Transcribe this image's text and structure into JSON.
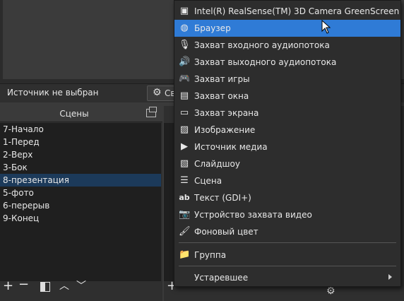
{
  "source_bar": {
    "label": "Источник не выбран",
    "button_label": "Св"
  },
  "scenes": {
    "title": "Сцены",
    "items": [
      "7-Начало",
      "1-Перед",
      "2-Верх",
      "3-Бок",
      "8-презентация",
      "5-фото",
      "6-перерыв",
      "9-Конец"
    ],
    "selected_index": 4
  },
  "menu": {
    "items": [
      {
        "label": "Intel(R) RealSense(TM) 3D Camera GreenScreen",
        "icon": "camera-frame-icon"
      },
      {
        "label": "Браузер",
        "icon": "globe-icon"
      },
      {
        "label": "Захват входного аудиопотока",
        "icon": "microphone-icon"
      },
      {
        "label": "Захват выходного аудиопотока",
        "icon": "speaker-icon"
      },
      {
        "label": "Захват игры",
        "icon": "gamepad-icon"
      },
      {
        "label": "Захват окна",
        "icon": "window-icon"
      },
      {
        "label": "Захват экрана",
        "icon": "monitor-icon"
      },
      {
        "label": "Изображение",
        "icon": "image-icon"
      },
      {
        "label": "Источник медиа",
        "icon": "play-icon"
      },
      {
        "label": "Слайдшоу",
        "icon": "slideshow-icon"
      },
      {
        "label": "Сцена",
        "icon": "list-icon"
      },
      {
        "label": "Текст (GDI+)",
        "icon": "text-icon"
      },
      {
        "label": "Устройство захвата видео",
        "icon": "camera-icon"
      },
      {
        "label": "Фоновый цвет",
        "icon": "brush-icon"
      },
      {
        "label": "Группа",
        "icon": "folder-icon"
      },
      {
        "label": "Устаревшее",
        "icon": ""
      }
    ],
    "highlighted_index": 1
  },
  "colors": {
    "highlight": "#2f7bd6",
    "selected_row": "#1c3a5a",
    "panel": "#2f2f2f",
    "list_bg": "#1f1f1f"
  }
}
